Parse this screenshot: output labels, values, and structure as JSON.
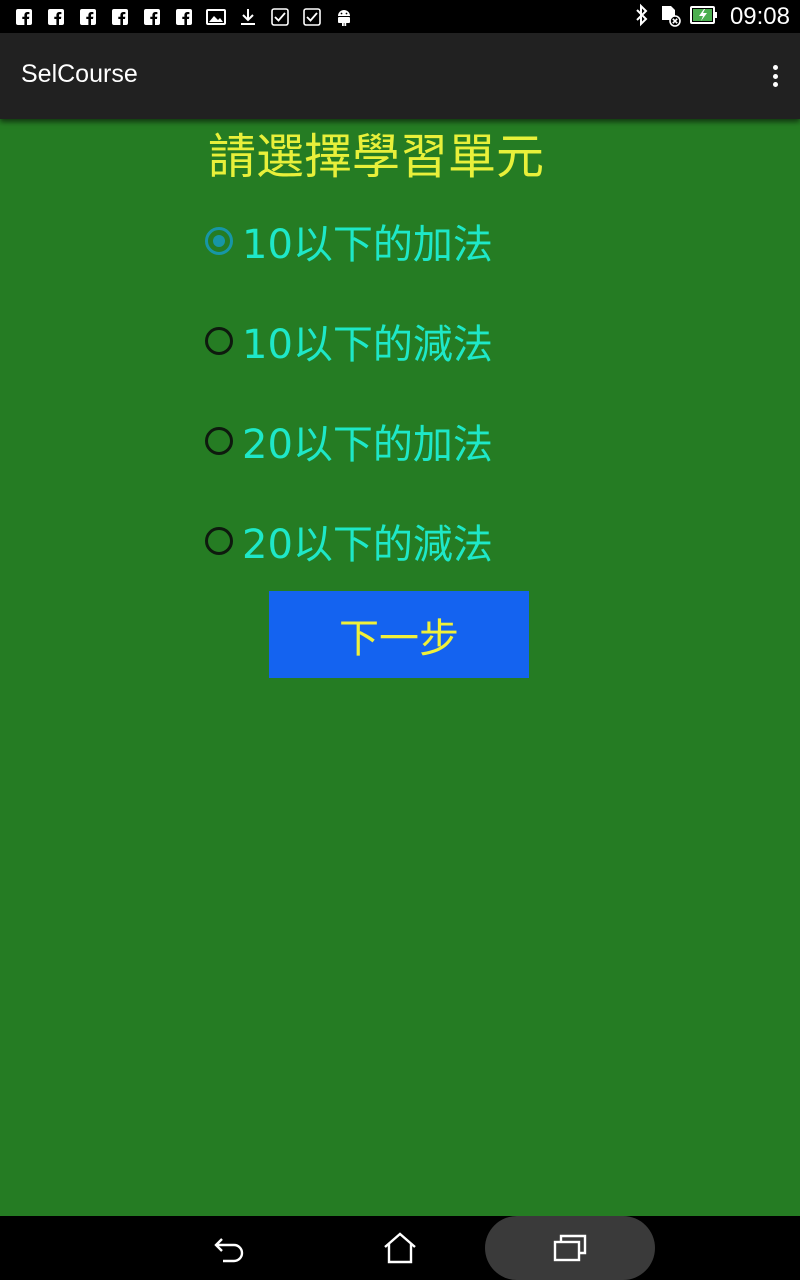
{
  "status_bar": {
    "time": "09:08",
    "left_icons": [
      "facebook-icon",
      "facebook-icon",
      "facebook-icon",
      "facebook-icon",
      "facebook-icon",
      "facebook-icon",
      "photo-icon",
      "download-icon",
      "checkbox-icon",
      "checkbox-icon",
      "android-icon"
    ],
    "right_icons": [
      "bluetooth-icon",
      "sd-card-icon",
      "battery-charging-icon"
    ]
  },
  "action_bar": {
    "title": "SelCourse",
    "menu_icon": "overflow-menu-icon"
  },
  "content": {
    "heading": "請選擇學習單元",
    "options": [
      {
        "label": "10以下的加法",
        "checked": true
      },
      {
        "label": "10以下的減法",
        "checked": false
      },
      {
        "label": "20以下的加法",
        "checked": false
      },
      {
        "label": "20以下的減法",
        "checked": false
      }
    ],
    "next_button": "下一步"
  },
  "nav_bar": {
    "back_icon": "back-icon",
    "home_icon": "home-icon",
    "recents_icon": "recents-icon"
  },
  "colors": {
    "background": "#257c23",
    "action_bar": "#212121",
    "heading": "#e8f03a",
    "option_text": "#1ee8c8",
    "radio_checked": "#1796a6",
    "button_bg": "#1463f0",
    "button_text": "#f0f03a"
  }
}
